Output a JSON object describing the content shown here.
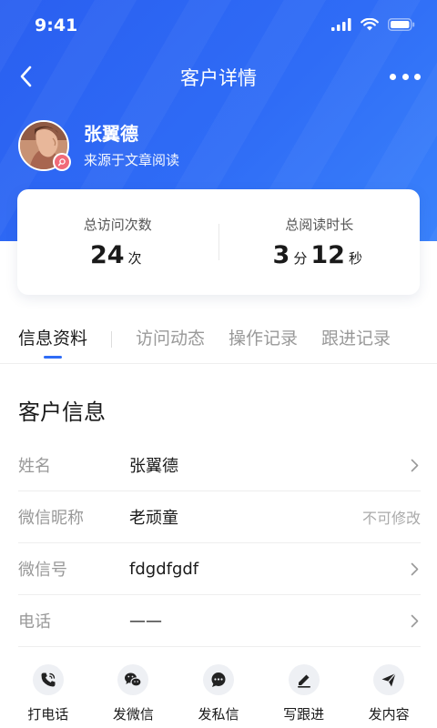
{
  "status_bar": {
    "time": "9:41"
  },
  "nav": {
    "title": "客户详情"
  },
  "profile": {
    "name": "张翼德",
    "source": "来源于文章阅读"
  },
  "stats": [
    {
      "label": "总访问次数",
      "value": "24",
      "unit": "次"
    },
    {
      "label": "总阅读时长",
      "minutes": "3",
      "minutes_unit": "分",
      "seconds": "12",
      "seconds_unit": "秒"
    }
  ],
  "tabs": [
    {
      "label": "信息资料",
      "active": true
    },
    {
      "label": "访问动态"
    },
    {
      "label": "操作记录"
    },
    {
      "label": "跟进记录"
    }
  ],
  "section": {
    "title": "客户信息"
  },
  "info_rows": [
    {
      "label": "姓名",
      "value": "张翼德"
    },
    {
      "label": "微信昵称",
      "value": "老顽童",
      "note": "不可修改"
    },
    {
      "label": "微信号",
      "value": "fdgdfgdf"
    },
    {
      "label": "电话",
      "value": "——"
    }
  ],
  "actions": [
    {
      "label": "打电话",
      "icon": "phone-icon"
    },
    {
      "label": "发微信",
      "icon": "wechat-icon"
    },
    {
      "label": "发私信",
      "icon": "message-icon"
    },
    {
      "label": "写跟进",
      "icon": "pen-icon"
    },
    {
      "label": "发内容",
      "icon": "send-icon"
    }
  ],
  "colors": {
    "primary": "#2f6cf6",
    "badge": "#f06a78"
  }
}
